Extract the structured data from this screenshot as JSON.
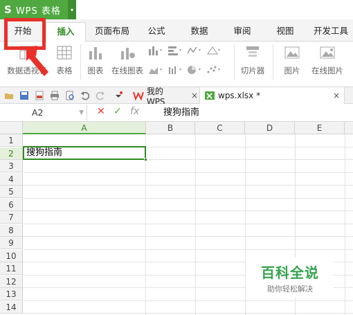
{
  "app": {
    "logo": "S",
    "name": "WPS 表格",
    "menu_arrow": "▾",
    "accent": "#4fa840"
  },
  "tabs": [
    {
      "label": "开始"
    },
    {
      "label": "插入"
    },
    {
      "label": "页面布局"
    },
    {
      "label": "公式"
    },
    {
      "label": "数据"
    },
    {
      "label": "审阅"
    },
    {
      "label": "视图"
    },
    {
      "label": "开发工具"
    }
  ],
  "active_tab": "插入",
  "highlight_color": "#e8312a",
  "ribbon": {
    "pivot_table": "数据透视表",
    "table": "表格",
    "chart": "图表",
    "online_chart": "在线图表",
    "slicer": "切片器",
    "picture": "图片",
    "online_picture": "在线图片"
  },
  "documents": [
    {
      "title": "我的WPS",
      "close": "×"
    },
    {
      "title": "wps.xlsx *",
      "close": "×"
    }
  ],
  "formula_bar": {
    "cell_ref": "A2",
    "cancel": "✕",
    "confirm": "✓",
    "fx": "fx",
    "content": "搜狗指南"
  },
  "grid": {
    "columns": [
      "A",
      "B",
      "C",
      "D",
      "E"
    ],
    "rows": [
      "1",
      "2",
      "3",
      "4",
      "5",
      "6",
      "7",
      "8",
      "9",
      "10",
      "11",
      "12",
      "13",
      "14"
    ],
    "selected_cell": "A2",
    "cell_a2": "搜狗指南"
  },
  "watermark": {
    "title": "百科全说",
    "subtitle": "助你轻松解决"
  }
}
